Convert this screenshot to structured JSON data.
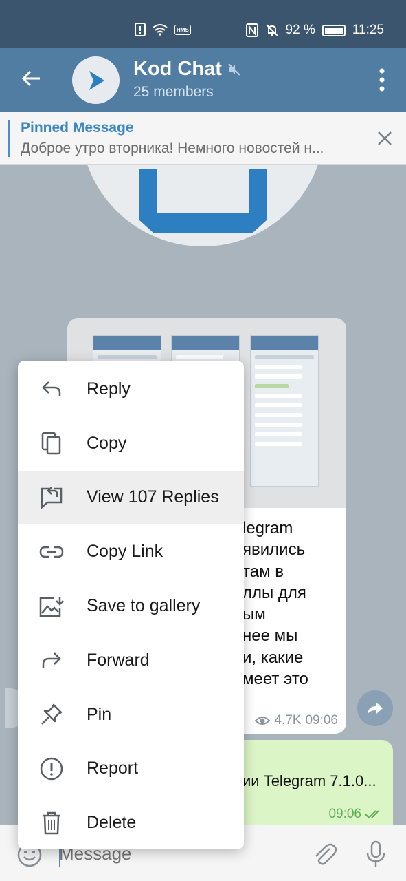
{
  "status_bar": {
    "battery_percent": "92 %",
    "time": "11:25",
    "hms_label": "HMS",
    "icons": [
      "alert-icon",
      "wifi-icon",
      "hms-icon",
      "nfc-icon",
      "bell-off-icon",
      "battery-icon"
    ]
  },
  "header": {
    "title": "Kod Chat",
    "subtitle": "25 members",
    "icons": [
      "back-arrow-icon",
      "play-logo-icon",
      "muted-speaker-icon",
      "more-vert-icon"
    ]
  },
  "pinned": {
    "title": "Pinned Message",
    "text": "Доброе утро вторника! Немного новостей н..."
  },
  "message": {
    "text_lines": [
      "legram",
      "явились",
      "там в",
      "ллы для",
      "ым",
      "нее мы",
      "и, какие",
      "меет это"
    ],
    "views": "4.7K",
    "time": "09:06"
  },
  "outgoing": {
    "text": "сии Telegram 7.1.0...",
    "time": "09:06"
  },
  "context_menu": {
    "items": [
      {
        "label": "Reply",
        "icon": "reply-icon"
      },
      {
        "label": "Copy",
        "icon": "copy-icon"
      },
      {
        "label": "View 107 Replies",
        "icon": "view-replies-icon"
      },
      {
        "label": "Copy Link",
        "icon": "link-icon"
      },
      {
        "label": "Save to gallery",
        "icon": "save-gallery-icon"
      },
      {
        "label": "Forward",
        "icon": "forward-icon"
      },
      {
        "label": "Pin",
        "icon": "pin-icon"
      },
      {
        "label": "Report",
        "icon": "report-icon"
      },
      {
        "label": "Delete",
        "icon": "delete-icon"
      }
    ]
  },
  "input": {
    "placeholder": "Message"
  },
  "colors": {
    "header": "#527da3",
    "status_bar": "#3b556f",
    "accent": "#3d86c6",
    "outgoing_bubble": "#dcf5c6",
    "check_green": "#5fae55"
  }
}
